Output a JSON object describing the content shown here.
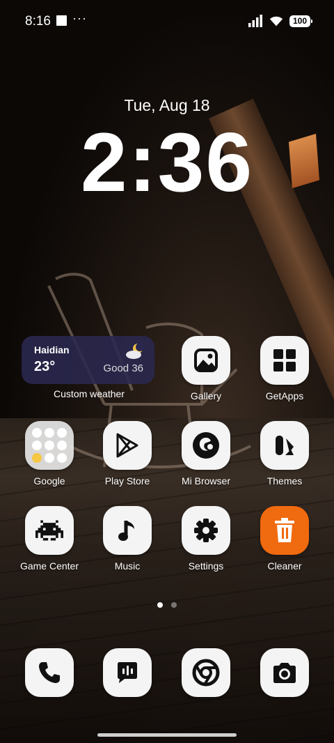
{
  "status_bar": {
    "time": "8:16",
    "battery": "100"
  },
  "lockscreen": {
    "date": "Tue, Aug 18",
    "time": "2:36"
  },
  "weather_widget": {
    "city": "Haidian",
    "temperature": "23°",
    "air_quality": "Good 36",
    "label": "Custom weather",
    "icon": "partly-cloudy-night-icon"
  },
  "apps": [
    {
      "label": "Gallery",
      "icon": "gallery-icon"
    },
    {
      "label": "GetApps",
      "icon": "getapps-icon"
    },
    {
      "label": "Google",
      "icon": "google-folder-icon"
    },
    {
      "label": "Play Store",
      "icon": "play-store-icon"
    },
    {
      "label": "Mi Browser",
      "icon": "mi-browser-icon"
    },
    {
      "label": "Themes",
      "icon": "themes-icon"
    },
    {
      "label": "Game Center",
      "icon": "game-center-icon"
    },
    {
      "label": "Music",
      "icon": "music-icon"
    },
    {
      "label": "Settings",
      "icon": "settings-icon"
    },
    {
      "label": "Cleaner",
      "icon": "cleaner-icon"
    }
  ],
  "dock": [
    {
      "icon": "phone-icon"
    },
    {
      "icon": "messages-icon"
    },
    {
      "icon": "chrome-icon"
    },
    {
      "icon": "camera-icon"
    }
  ],
  "pages": {
    "current": 1,
    "total": 2
  },
  "colors": {
    "icon_bg": "#f4f4f4",
    "cleaner_accent": "#f06a0f",
    "widget_bg": "#2a2850"
  }
}
